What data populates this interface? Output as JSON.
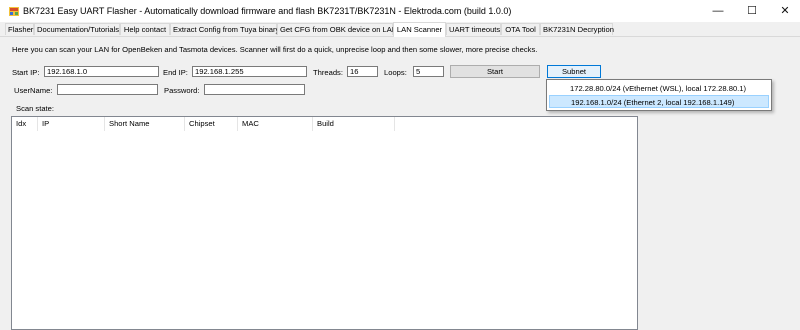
{
  "window": {
    "title": "BK7231 Easy UART Flasher - Automatically download firmware and flash BK7231T/BK7231N  - Elektroda.com (build 1.0.0)",
    "minimize": "—",
    "maximize": "☐",
    "close": "✕"
  },
  "tabs": [
    {
      "label": "Flasher"
    },
    {
      "label": "Documentation/Tutorials"
    },
    {
      "label": "Help contact"
    },
    {
      "label": "Extract Config from Tuya binary"
    },
    {
      "label": "Get CFG from OBK device on LAN"
    },
    {
      "label": "LAN Scanner",
      "active": true
    },
    {
      "label": "UART timeouts"
    },
    {
      "label": "OTA Tool"
    },
    {
      "label": "BK7231N Decryption"
    }
  ],
  "scanner": {
    "info": "Here you can scan your LAN for OpenBeken and Tasmota devices. Scanner will first do a quick, unprecise loop and then some slower, more precise checks.",
    "start_ip_label": "Start IP:",
    "start_ip": "192.168.1.0",
    "end_ip_label": "End IP:",
    "end_ip": "192.168.1.255",
    "threads_label": "Threads:",
    "threads": "16",
    "loops_label": "Loops:",
    "loops": "5",
    "start_button": "Start",
    "subnet_button": "Subnet",
    "username_label": "UserName:",
    "username": "",
    "password_label": "Password:",
    "password": "",
    "scan_state_label": "Scan state:",
    "subnet_options": [
      "172.28.80.0/24 (vEthernet (WSL), local 172.28.80.1)",
      "192.168.1.0/24 (Ethernet 2, local 192.168.1.149)"
    ],
    "selected_subnet_index": 1
  },
  "table": {
    "columns": [
      "Idx",
      "IP",
      "Short Name",
      "Chipset",
      "MAC",
      "Build"
    ],
    "rows": []
  },
  "colors": {
    "selection": "#cce8ff",
    "focus_border": "#0078d7"
  }
}
